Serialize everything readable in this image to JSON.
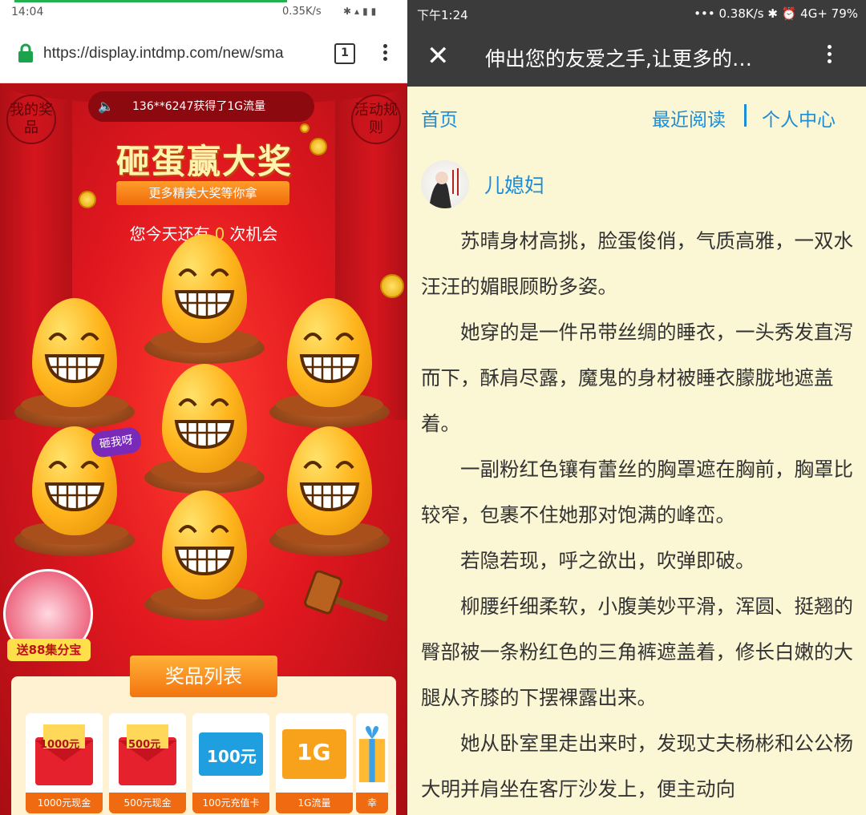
{
  "left": {
    "status": {
      "time": "14:04",
      "speed": "0.35K/s"
    },
    "url": "https://display.intdmp.com/new/sma",
    "tab_count": "1",
    "my_prizes": "我的奖品",
    "rules": "活动规则",
    "ticker": "136**6247获得了1G流量",
    "title": "砸蛋赢大奖",
    "subtitle": "更多精美大奖等你拿",
    "chances_prefix": "您今天还有",
    "chances_count": "0",
    "chances_suffix": "次机会",
    "hit_me": "砸我呀",
    "badge": "送88集分宝",
    "prize_list_title": "奖品列表",
    "prizes": [
      {
        "tag": "1000元",
        "caption": "1000元现金"
      },
      {
        "tag": "500元",
        "caption": "500元现金"
      },
      {
        "tag": "100元",
        "caption": "100元充值卡"
      },
      {
        "tag": "1G",
        "caption": "1G流量"
      },
      {
        "tag": "",
        "caption": "幸"
      }
    ]
  },
  "right": {
    "status": {
      "time": "下午1:24",
      "right": "••• 0.38K/s ✱ ⏰ 4G+ 79%"
    },
    "title": "伸出您的友爱之手,让更多的…",
    "nav": {
      "home": "首页",
      "recent": "最近阅读",
      "center": "个人中心"
    },
    "author": "儿媳妇",
    "paragraphs": [
      "苏晴身材高挑，脸蛋俊俏，气质高雅，一双水汪汪的媚眼顾盼多姿。",
      "她穿的是一件吊带丝绸的睡衣，一头秀发直泻而下，酥肩尽露，魔鬼的身材被睡衣朦胧地遮盖着。",
      "一副粉红色镶有蕾丝的胸罩遮在胸前，胸罩比较窄，包裹不住她那对饱满的峰峦。",
      "若隐若现，呼之欲出，吹弹即破。",
      "柳腰纤细柔软，小腹美妙平滑，浑圆、挺翘的臀部被一条粉红色的三角裤遮盖着，修长白嫩的大腿从齐膝的下摆裸露出来。",
      "她从卧室里走出来时，发现丈夫杨彬和公公杨大明并肩坐在客厅沙发上，便主动向"
    ]
  }
}
